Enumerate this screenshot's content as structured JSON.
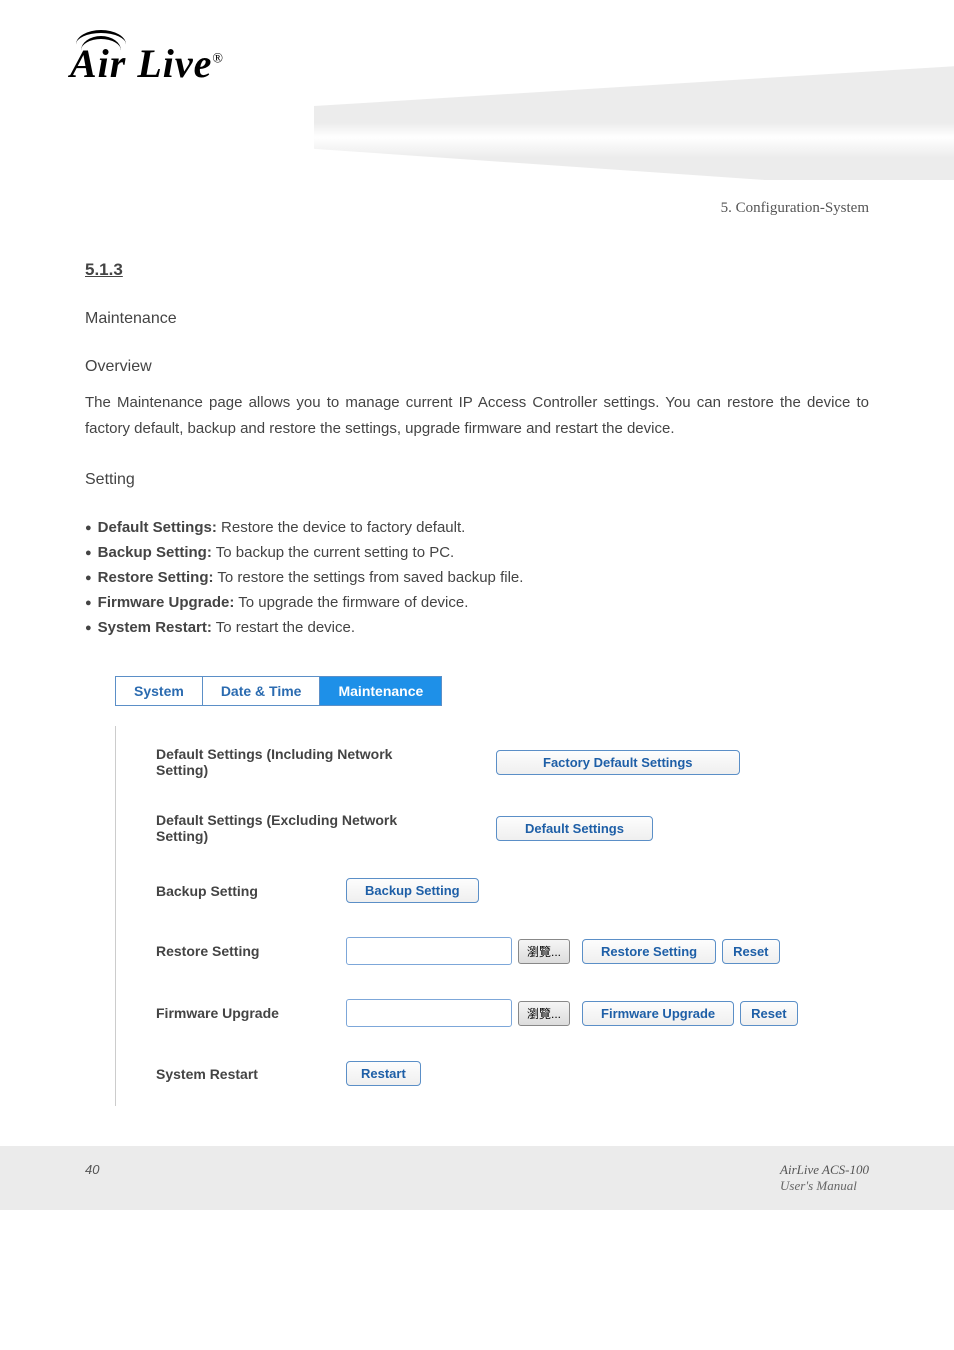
{
  "header": {
    "logo_text": "Air Live",
    "reg": "®",
    "chapter": "5. Configuration-System"
  },
  "section": {
    "number": "5.1.3",
    "heading": "Maintenance",
    "overview_title": "Overview",
    "overview_para": "The Maintenance page allows you to manage current IP Access Controller settings. You can restore the device to factory default, backup and restore the settings, upgrade firmware and restart the device.",
    "setting_title": "Setting",
    "items": [
      {
        "label": "Default Settings:",
        "text": "Restore the device to factory default."
      },
      {
        "label": "Backup Setting:",
        "text": "To backup the current setting to PC."
      },
      {
        "label": "Restore Setting:",
        "text": "To restore the settings from saved backup file."
      },
      {
        "label": "Firmware Upgrade:",
        "text": "To upgrade the firmware of device."
      },
      {
        "label": "System Restart:",
        "text": "To restart the device."
      }
    ]
  },
  "ui": {
    "tabs": {
      "system": "System",
      "datetime": "Date & Time",
      "maintenance": "Maintenance"
    },
    "rows": {
      "def_incl": {
        "label": "Default Settings (Including Network Setting)",
        "button": "Factory Default Settings"
      },
      "def_excl": {
        "label": "Default Settings (Excluding Network Setting)",
        "button": "Default Settings"
      },
      "backup": {
        "label": "Backup Setting",
        "button": "Backup Setting"
      },
      "restore": {
        "label": "Restore Setting",
        "browse": "瀏覽...",
        "button": "Restore Setting",
        "reset": "Reset"
      },
      "fw": {
        "label": "Firmware Upgrade",
        "browse": "瀏覽...",
        "button": "Firmware Upgrade",
        "reset": "Reset"
      },
      "restart": {
        "label": "System Restart",
        "button": "Restart"
      }
    }
  },
  "footer": {
    "page": "40",
    "product": "AirLive ACS-100",
    "manual": "User's Manual"
  }
}
